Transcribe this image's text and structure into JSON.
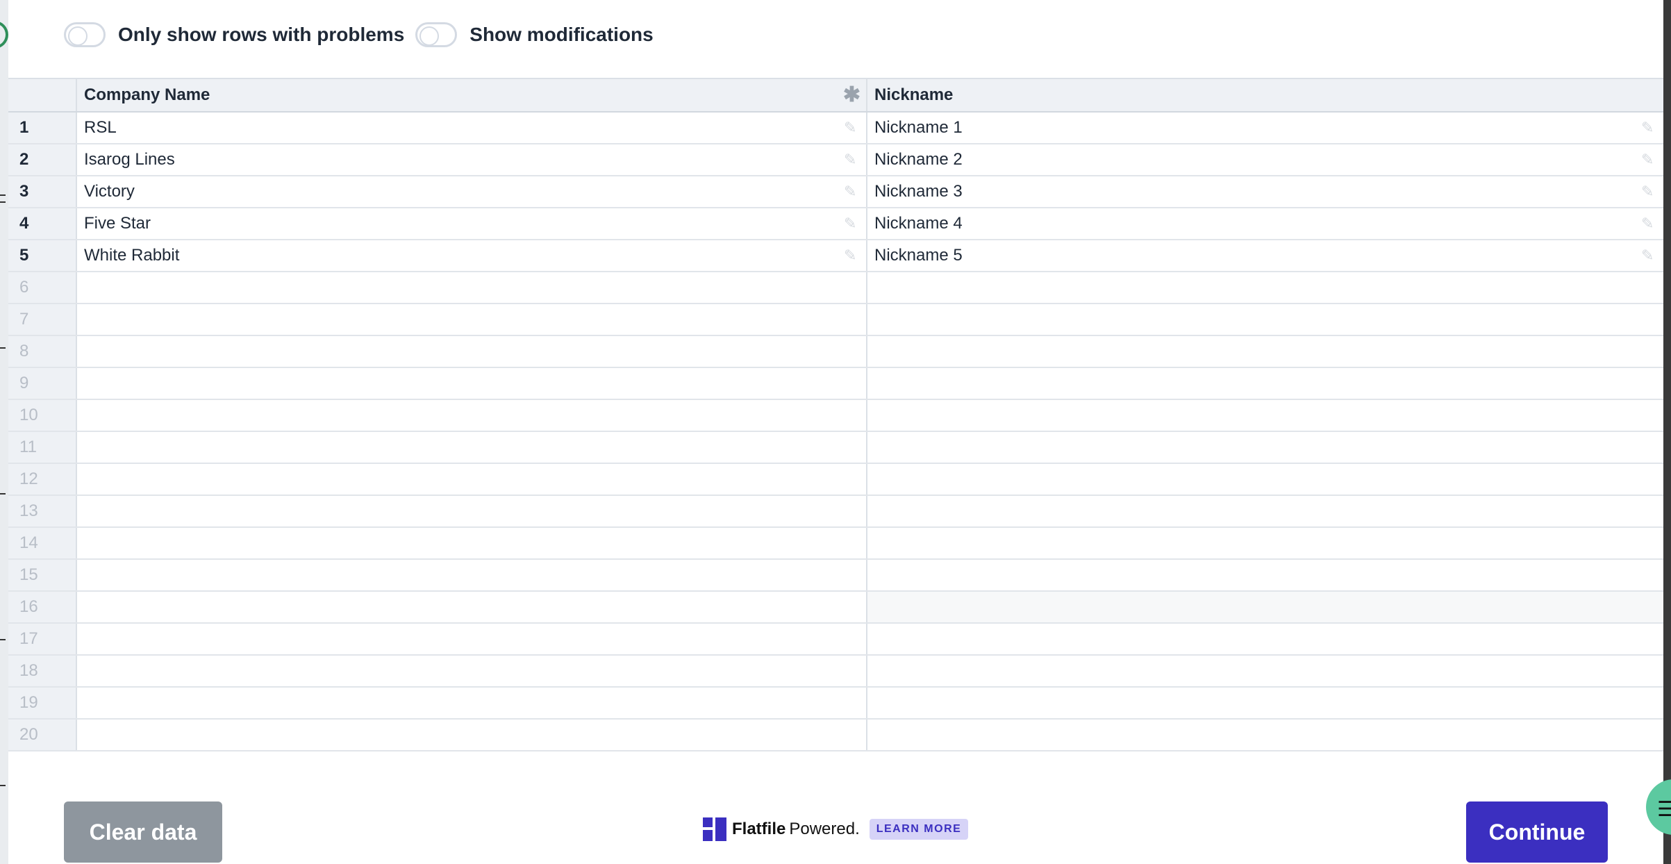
{
  "toggles": [
    {
      "label": "Only show rows with problems",
      "on": false
    },
    {
      "label": "Show modifications",
      "on": false
    }
  ],
  "grid": {
    "columns": [
      {
        "label": "Company Name",
        "required": true
      },
      {
        "label": "Nickname",
        "required": false
      }
    ],
    "rows": [
      {
        "num": "1",
        "company": "RSL",
        "nickname": "Nickname 1"
      },
      {
        "num": "2",
        "company": "Isarog Lines",
        "nickname": "Nickname 2"
      },
      {
        "num": "3",
        "company": "Victory",
        "nickname": "Nickname 3"
      },
      {
        "num": "4",
        "company": "Five Star",
        "nickname": "Nickname 4"
      },
      {
        "num": "5",
        "company": "White Rabbit",
        "nickname": "Nickname 5"
      },
      {
        "num": "6",
        "company": "",
        "nickname": ""
      },
      {
        "num": "7",
        "company": "",
        "nickname": ""
      },
      {
        "num": "8",
        "company": "",
        "nickname": ""
      },
      {
        "num": "9",
        "company": "",
        "nickname": ""
      },
      {
        "num": "10",
        "company": "",
        "nickname": ""
      },
      {
        "num": "11",
        "company": "",
        "nickname": ""
      },
      {
        "num": "12",
        "company": "",
        "nickname": ""
      },
      {
        "num": "13",
        "company": "",
        "nickname": ""
      },
      {
        "num": "14",
        "company": "",
        "nickname": ""
      },
      {
        "num": "15",
        "company": "",
        "nickname": ""
      },
      {
        "num": "16",
        "company": "",
        "nickname": ""
      },
      {
        "num": "17",
        "company": "",
        "nickname": ""
      },
      {
        "num": "18",
        "company": "",
        "nickname": ""
      },
      {
        "num": "19",
        "company": "",
        "nickname": ""
      },
      {
        "num": "20",
        "company": "",
        "nickname": ""
      }
    ]
  },
  "footer": {
    "clear_label": "Clear data",
    "brand_name": "Flatfile",
    "brand_suffix": "Powered.",
    "learn_more": "LEARN MORE",
    "continue_label": "Continue"
  },
  "colors": {
    "accent": "#3b2fc0",
    "clear_button": "#8e969e",
    "chat_bubble": "#5cc9a0"
  }
}
